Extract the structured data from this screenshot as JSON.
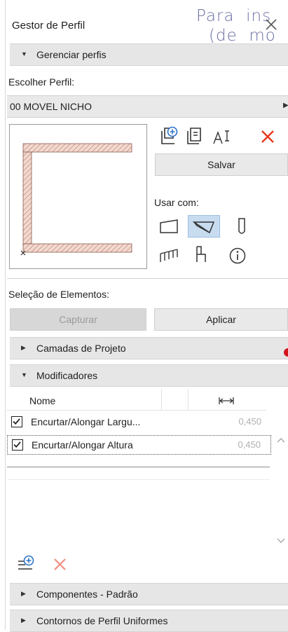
{
  "overlay": {
    "line1": "Para  ins",
    "line2": "(de  mo"
  },
  "panel": {
    "title": "Gestor de Perfil"
  },
  "manage_section": {
    "label": "Gerenciar perfis"
  },
  "profile": {
    "choose_label": "Escolher Perfil:",
    "selected": "00 MOVEL NICHO",
    "save_label": "Salvar",
    "use_with_label": "Usar com:"
  },
  "element_selection": {
    "label": "Seleção de Elementos:",
    "capture_label": "Capturar",
    "apply_label": "Aplicar"
  },
  "layers_section": {
    "label": "Camadas de Projeto"
  },
  "modifiers_section": {
    "label": "Modificadores",
    "col_name": "Nome",
    "rows": [
      {
        "name": "Encurtar/Alongar Largu...",
        "value": "0,450",
        "checked": true
      },
      {
        "name": "Encurtar/Alongar Altura",
        "value": "0,450",
        "checked": true
      }
    ]
  },
  "components_section": {
    "label": "Componentes - Padrão"
  },
  "contours_section": {
    "label": "Contornos de Perfil Uniformes"
  },
  "colors": {
    "accent_red": "#e8391d",
    "selected_tool_bg": "#c8dcf0",
    "status_dot": "#d0161b"
  }
}
